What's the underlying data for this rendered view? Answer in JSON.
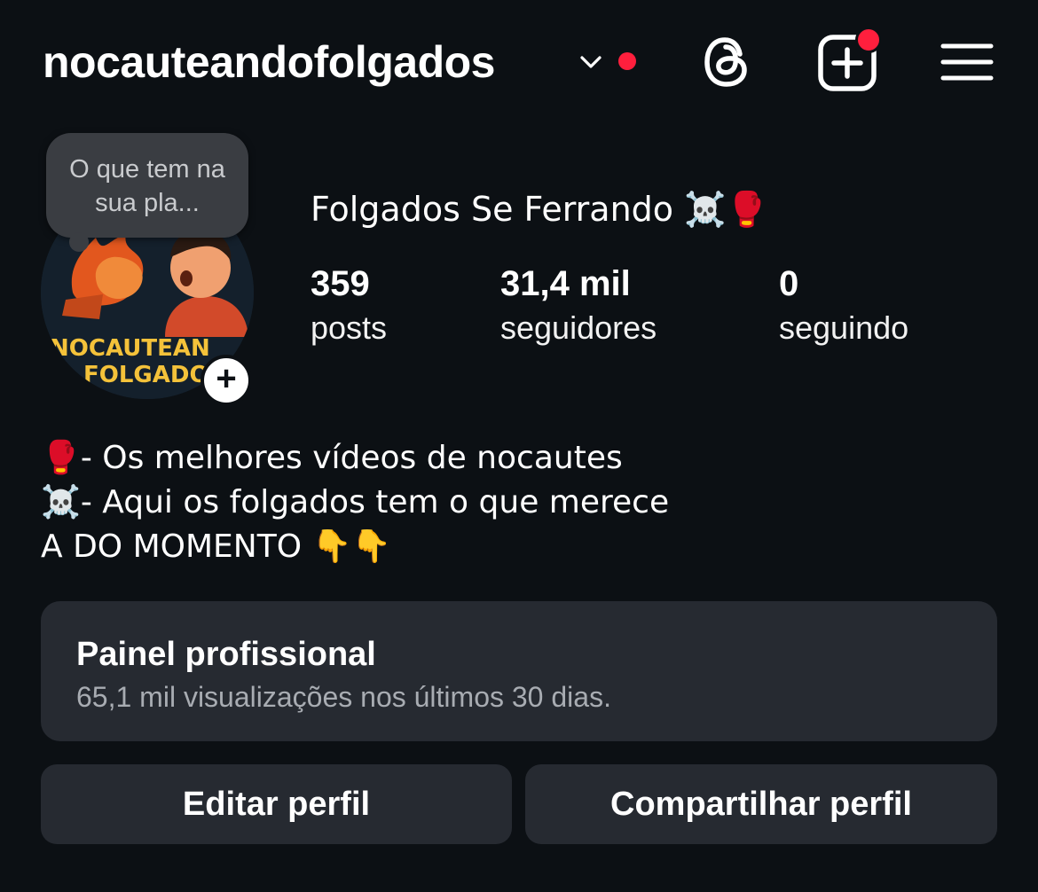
{
  "header": {
    "username": "nocauteandofolgados",
    "icons": [
      "chevron-down-icon",
      "notification-dot",
      "threads-icon",
      "new-post-icon",
      "menu-icon"
    ]
  },
  "profile": {
    "note": "O que tem na sua pla...",
    "avatar_text_line1": "NOCAUTEAN",
    "avatar_text_line2": "FOLGADO",
    "add_label": "+",
    "display_name": "Folgados Se Ferrando ☠️🥊",
    "stats": {
      "posts_count": "359",
      "posts_label": "posts",
      "followers_count": "31,4 mil",
      "followers_label": "seguidores",
      "following_count": "0",
      "following_label": "seguindo"
    }
  },
  "bio": {
    "line1": "🥊- Os melhores vídeos de nocautes",
    "line2": "☠️- Aqui os folgados tem o que merece",
    "line3": "A DO MOMENTO  👇👇"
  },
  "dashboard": {
    "title": "Painel profissional",
    "subtitle": "65,1 mil visualizações nos últimos 30 dias."
  },
  "actions": {
    "edit_label": "Editar perfil",
    "share_label": "Compartilhar perfil"
  },
  "colors": {
    "background": "#0c1014",
    "card": "#262a31",
    "accent_red": "#ff1f3d",
    "avatar_text": "#f4c23a"
  }
}
